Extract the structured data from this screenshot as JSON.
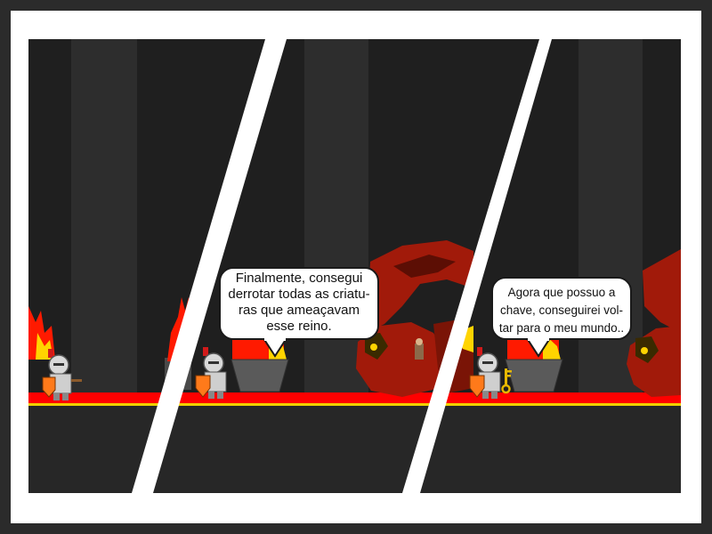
{
  "comic": {
    "panels": [
      {
        "id": "panel-1",
        "characters": [
          "knight",
          "torch"
        ]
      },
      {
        "id": "panel-2",
        "characters": [
          "knight",
          "brazier",
          "dragon",
          "npc"
        ],
        "speech": {
          "lines": [
            "Finalmente, consegui",
            "derrotar todas as criatu-",
            "ras que ameaçavam",
            "esse reino."
          ]
        }
      },
      {
        "id": "panel-3",
        "characters": [
          "knight",
          "key",
          "brazier",
          "dragon"
        ],
        "speech": {
          "lines": [
            "Agora que possuo a",
            "chave, conseguirei vol-",
            "tar para o meu mundo.."
          ]
        }
      }
    ]
  },
  "colors": {
    "outer_background": "#2b2b2b",
    "frame": "#ffffff",
    "scene_background": "#1f1f1f",
    "pillar": "#2d2d2d",
    "floor_red": "#ff0000",
    "floor_yellow": "#f0d000",
    "ground": "#272727",
    "flame_red": "#ff1a00",
    "flame_yellow": "#ffd400",
    "brazier": "#5a5a5a",
    "dragon_red": "#a11a0a",
    "dragon_dark": "#5c0e04",
    "knight_armor": "#d9d9d9",
    "knight_plume": "#d11a1a",
    "shield": "#ff7a1a",
    "key": "#e6b800"
  },
  "icons": [
    "knight-sprite",
    "dragon-sprite",
    "torch-flame",
    "brazier-icon",
    "key-icon",
    "npc-sprite"
  ]
}
